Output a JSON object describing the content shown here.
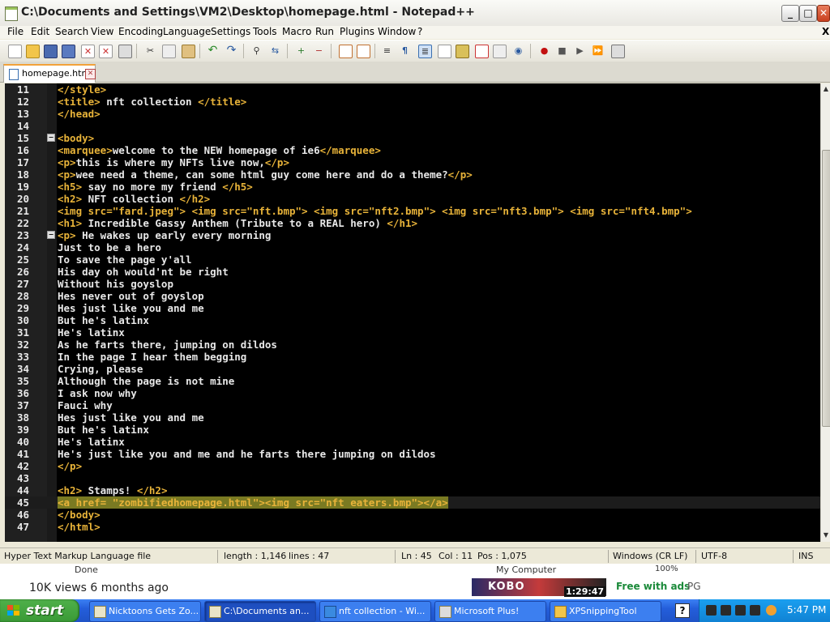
{
  "window": {
    "title": "C:\\Documents and Settings\\VM2\\Desktop\\homepage.html - Notepad++",
    "minimize": "_",
    "maximize": "□",
    "close": "✕"
  },
  "menu": [
    "File",
    "Edit",
    "Search",
    "View",
    "Encoding",
    "Language",
    "Settings",
    "Tools",
    "Macro",
    "Run",
    "Plugins",
    "Window",
    "?"
  ],
  "menu_close": "X",
  "tab": {
    "label": "homepage.html",
    "close": "✕"
  },
  "editor": {
    "lines": [
      {
        "n": "11",
        "code": "</style>"
      },
      {
        "n": "12",
        "code": "<title> nft collection </title>"
      },
      {
        "n": "13",
        "code": "</head>"
      },
      {
        "n": "14",
        "code": ""
      },
      {
        "n": "15",
        "code": "<body>",
        "fold": "−"
      },
      {
        "n": "16",
        "code": "<marquee>welcome to the NEW homepage of ie6</marquee>"
      },
      {
        "n": "17",
        "code": "<p>this is where my NFTs live now,</p>"
      },
      {
        "n": "18",
        "code": "<p>wee need a theme, can some html guy come here and do a theme?</p>"
      },
      {
        "n": "19",
        "code": "<h5> say no more my friend </h5>"
      },
      {
        "n": "20",
        "code": "<h2> NFT collection </h2>"
      },
      {
        "n": "21",
        "code": "<img src=\"fard.jpeg\"> <img src=\"nft.bmp\"> <img src=\"nft2.bmp\"> <img src=\"nft3.bmp\"> <img src=\"nft4.bmp\">"
      },
      {
        "n": "22",
        "code": "<h1> Incredible Gassy Anthem (Tribute to a REAL hero) </h1>"
      },
      {
        "n": "23",
        "code": "<p> He wakes up early every morning",
        "fold": "−"
      },
      {
        "n": "24",
        "code": "Just to be a hero"
      },
      {
        "n": "25",
        "code": "To save the page y'all"
      },
      {
        "n": "26",
        "code": "His day oh would'nt be right"
      },
      {
        "n": "27",
        "code": "Without his goyslop"
      },
      {
        "n": "28",
        "code": "Hes never out of goyslop"
      },
      {
        "n": "29",
        "code": "Hes just like you and me"
      },
      {
        "n": "30",
        "code": "But he's latinx"
      },
      {
        "n": "31",
        "code": "He's latinx"
      },
      {
        "n": "32",
        "code": "As he farts there, jumping on dildos"
      },
      {
        "n": "33",
        "code": "In the page I hear them begging"
      },
      {
        "n": "34",
        "code": "Crying, please"
      },
      {
        "n": "35",
        "code": "Although the page is not mine"
      },
      {
        "n": "36",
        "code": "I ask now why"
      },
      {
        "n": "37",
        "code": "Fauci why"
      },
      {
        "n": "38",
        "code": "Hes just like you and me"
      },
      {
        "n": "39",
        "code": "But he's latinx"
      },
      {
        "n": "40",
        "code": "He's latinx"
      },
      {
        "n": "41",
        "code": "He's just like you and me and he farts there jumping on dildos"
      },
      {
        "n": "42",
        "code": "</p>"
      },
      {
        "n": "43",
        "code": ""
      },
      {
        "n": "44",
        "code": "<h2> Stamps! </h2>"
      },
      {
        "n": "45",
        "code": "<a href= \"zombifiedhomepage.html\"><img src=\"nft eaters.bmp\"></a>",
        "current": true
      },
      {
        "n": "46",
        "code": "</body>"
      },
      {
        "n": "47",
        "code": "</html>"
      }
    ]
  },
  "status": {
    "type": "Hyper Text Markup Language file",
    "length": "length : 1,146",
    "lines": "lines : 47",
    "ln": "Ln : 45",
    "col": "Col : 11",
    "pos": "Pos : 1,075",
    "eol": "Windows (CR LF)",
    "encoding": "UTF-8",
    "mode": "INS"
  },
  "overlay": {
    "views": "10K views  6 months ago",
    "done": "Done",
    "my_computer": "My Computer",
    "zoom": "100%",
    "ad_text": "KOBO",
    "timestamp": "1:29:47",
    "free_ads": "Free with ads",
    "rating": "PG"
  },
  "taskbar": {
    "start": "start",
    "tasks": [
      {
        "label": "Nicktoons Gets Zo..."
      },
      {
        "label": "C:\\Documents an...",
        "active": true
      },
      {
        "label": "nft collection - Wi..."
      },
      {
        "label": "Microsoft Plus!"
      },
      {
        "label": "XPSnippingTool"
      }
    ],
    "help": "?",
    "clock": "5:47 PM"
  },
  "colors": {
    "editor_bg": "#000000",
    "tag": "#e8b339",
    "text": "#e8e8e8",
    "selection": "#7a7a22",
    "taskbar": "#245edb",
    "start": "#3a9a36"
  }
}
